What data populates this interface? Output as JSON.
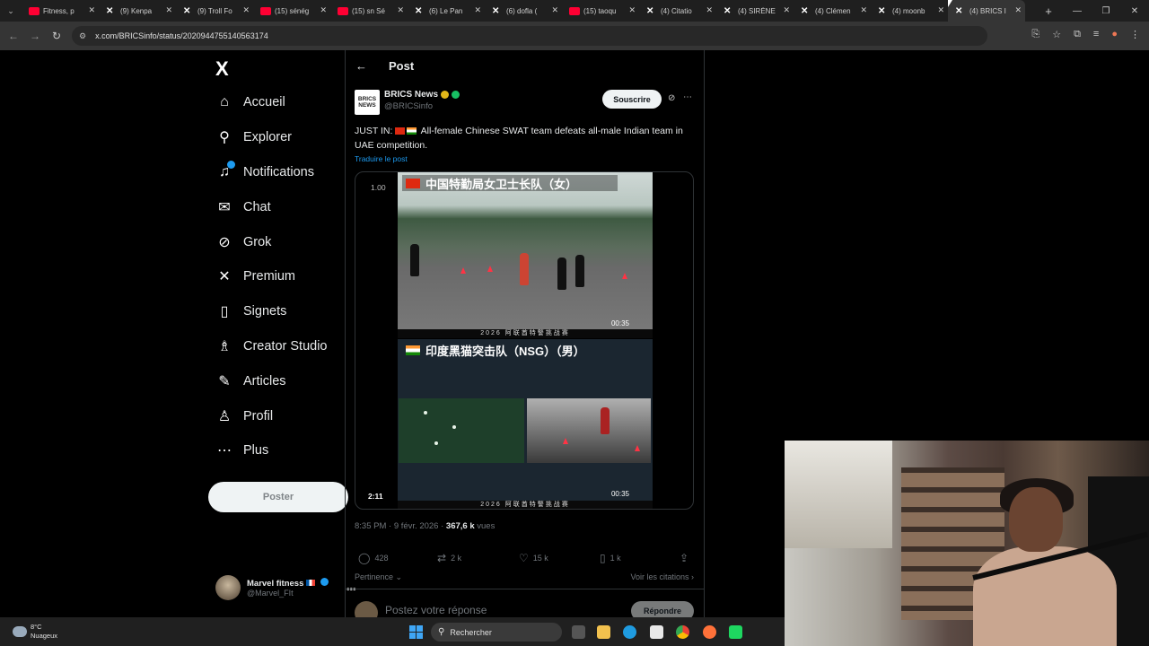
{
  "browser": {
    "tabs": [
      {
        "icon": "youtube-icon",
        "title": "Fitness, p"
      },
      {
        "icon": "x-icon",
        "title": "(9) Kenpa"
      },
      {
        "icon": "x-icon",
        "title": "(9) Troll Fo"
      },
      {
        "icon": "youtube-icon",
        "title": "(15) sénég"
      },
      {
        "icon": "youtube-icon",
        "title": "(15) sn Sé"
      },
      {
        "icon": "x-icon",
        "title": "(6) Le Pan"
      },
      {
        "icon": "x-icon",
        "title": "(6) dofla ("
      },
      {
        "icon": "youtube-icon",
        "title": "(15) taoqu"
      },
      {
        "icon": "x-icon",
        "title": "(4) Citatio"
      },
      {
        "icon": "x-icon",
        "title": "(4) SIRÈNE"
      },
      {
        "icon": "x-icon",
        "title": "(4) Clémen"
      },
      {
        "icon": "x-icon",
        "title": "(4) moonb"
      },
      {
        "icon": "x-icon",
        "title": "(4) BRICS I"
      }
    ],
    "url": "x.com/BRICSinfo/status/2020944755140563174"
  },
  "sidebar": {
    "logo": "X",
    "items": [
      {
        "icon": "home-icon",
        "glyph": "⌂",
        "label": "Accueil"
      },
      {
        "icon": "search-icon",
        "glyph": "⚲",
        "label": "Explorer"
      },
      {
        "icon": "bell-icon",
        "glyph": "♫",
        "label": "Notifications"
      },
      {
        "icon": "mail-icon",
        "glyph": "✉",
        "label": "Chat"
      },
      {
        "icon": "grok-icon",
        "glyph": "⊘",
        "label": "Grok"
      },
      {
        "icon": "x-premium-icon",
        "glyph": "✕",
        "label": "Premium"
      },
      {
        "icon": "bookmark-icon",
        "glyph": "▯",
        "label": "Signets"
      },
      {
        "icon": "creator-icon",
        "glyph": "♗",
        "label": "Creator Studio"
      },
      {
        "icon": "articles-icon",
        "glyph": "✎",
        "label": "Articles"
      },
      {
        "icon": "profile-icon",
        "glyph": "♙",
        "label": "Profil"
      },
      {
        "icon": "more-icon",
        "glyph": "⋯",
        "label": "Plus"
      }
    ],
    "post_button": "Poster",
    "account": {
      "name": "Marvel fitness",
      "handle": "@Marvel_FIt"
    }
  },
  "post": {
    "header_title": "Post",
    "author": {
      "name": "BRICS News",
      "handle": "@BRICSinfo",
      "logo_top": "BRICS",
      "logo_bottom": "NEWS"
    },
    "subscribe": "Souscrire",
    "text_prefix": "JUST IN:",
    "text": "All-female Chinese SWAT team defeats all-male Indian team in UAE competition.",
    "translate": "Traduire le post",
    "media": {
      "speed": "1.00",
      "duration": "2:11",
      "top_title": "中国特勤局女卫士长队（女）",
      "top_timer": "00:35",
      "bottom_title": "印度黑猫突击队（NSG）（男）",
      "bottom_timer": "00:35",
      "banner": "2026 阿联酋特警挑战赛"
    },
    "time": "8:35 PM · 9 févr. 2026 ·",
    "views_count": "367,6 k",
    "views_label": "vues",
    "stats": {
      "replies": "428",
      "reposts": "2 k",
      "likes": "15 k",
      "bookmarks": "1 k"
    },
    "sort_label": "Pertinence",
    "quotes_link": "Voir les citations",
    "reply_placeholder": "Postez votre réponse",
    "reply_button": "Répondre"
  },
  "taskbar": {
    "weather_temp": "8°C",
    "weather_desc": "Nuageux",
    "search_placeholder": "Rechercher"
  },
  "colors": {
    "accent": "#1d9bf0",
    "background": "#000000",
    "border": "#2f3336"
  }
}
